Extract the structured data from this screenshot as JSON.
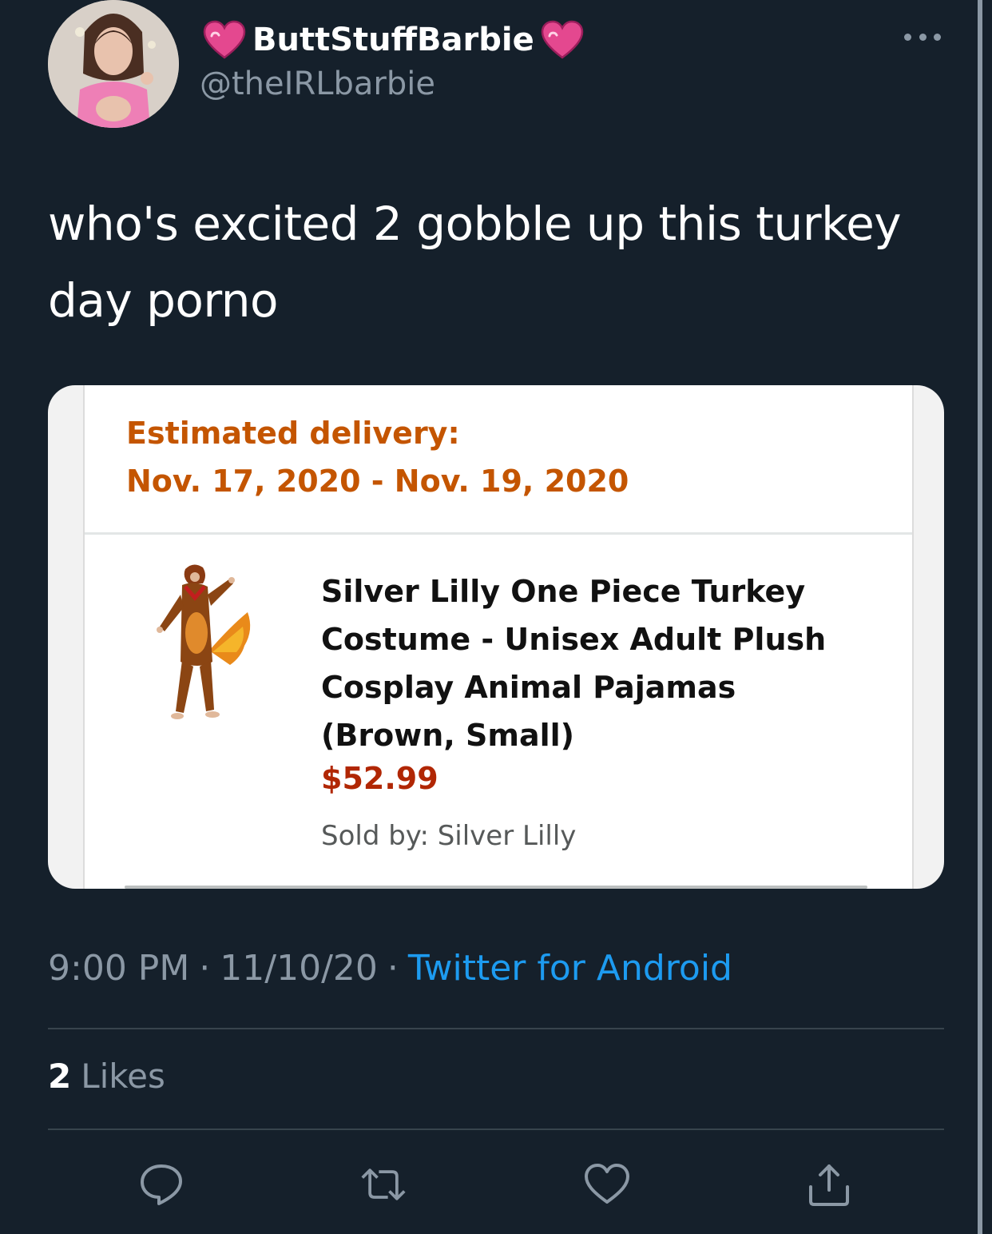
{
  "author": {
    "display_name": "ButtStuffBarbie",
    "handle": "@theIRLbarbie",
    "name_emoji": "sparkling-heart-icon"
  },
  "tweet": {
    "text": "who's excited 2 gobble up this turkey day porno"
  },
  "attachment": {
    "delivery_label": "Estimated delivery:",
    "delivery_dates": "Nov. 17, 2020 - Nov. 19, 2020",
    "product_title": "Silver Lilly One Piece Turkey Costume - Unisex Adult Plush Cosplay Animal Pajamas (Brown, Small)",
    "price": "$52.99",
    "seller": "Sold by: Silver Lilly"
  },
  "meta": {
    "time": "9:00 PM",
    "separator": "·",
    "date": "11/10/20",
    "source": "Twitter for Android"
  },
  "stats": {
    "likes_count": "2",
    "likes_label": "Likes"
  },
  "actions": [
    "reply-icon",
    "retweet-icon",
    "like-icon",
    "share-icon"
  ],
  "colors": {
    "background": "#15202b",
    "secondary_text": "#8b98a5",
    "link": "#1d9bf0",
    "divider": "#38444d",
    "delivery_orange": "#c45500",
    "price_red": "#b12704",
    "heart_pink": "#e4488f"
  }
}
